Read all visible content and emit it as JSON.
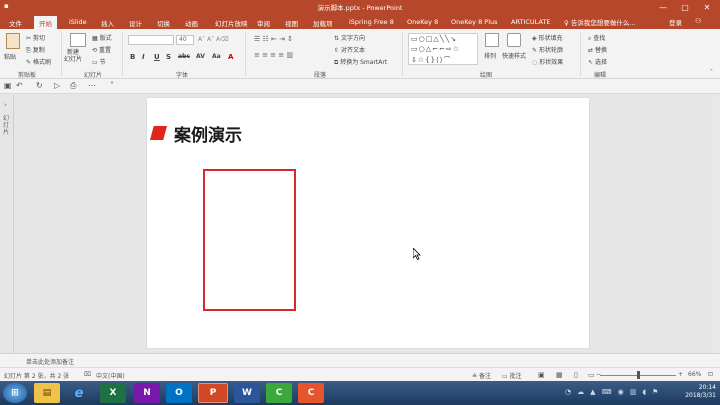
{
  "window": {
    "title": "演示脚本.pptx - PowerPoint",
    "controls": [
      "—",
      "▢",
      "✕"
    ]
  },
  "tabs": [
    {
      "label": "文件",
      "active": false
    },
    {
      "label": "开始",
      "active": true
    },
    {
      "label": "iSlide",
      "active": false
    },
    {
      "label": "插入",
      "active": false
    },
    {
      "label": "设计",
      "active": false
    },
    {
      "label": "切换",
      "active": false
    },
    {
      "label": "动画",
      "active": false
    },
    {
      "label": "幻灯片放映",
      "active": false
    },
    {
      "label": "审阅",
      "active": false
    },
    {
      "label": "视图",
      "active": false
    },
    {
      "label": "加载项",
      "active": false
    },
    {
      "label": "iSpring Free 8",
      "active": false
    },
    {
      "label": "OneKey 8",
      "active": false
    },
    {
      "label": "OneKey 8 Plus",
      "active": false
    },
    {
      "label": "ARTICULATE",
      "active": false
    }
  ],
  "tell_me": "告诉我您想要做什么...",
  "login": "登录",
  "share_icon": "person-share-icon",
  "ribbon": {
    "clipboard": {
      "paste": "粘贴",
      "cut": "剪切",
      "copy": "复制",
      "format_painter": "格式刷",
      "group_label": "剪贴板"
    },
    "slides": {
      "new_slide": "新建\n幻灯片",
      "layout": "版式",
      "reset": "重置",
      "section": "节",
      "group_label": "幻灯片"
    },
    "font": {
      "font_name": "",
      "font_size": "40",
      "group_label": "字体",
      "buttons": [
        "B",
        "I",
        "U",
        "S",
        "abc",
        "AV",
        "Aa",
        "A"
      ]
    },
    "paragraph": {
      "text_direction": "文字方向",
      "align_text": "对齐文本",
      "smartart": "转换为 SmartArt",
      "group_label": "段落"
    },
    "drawing": {
      "arrange": "排列",
      "quick_styles": "快速样式",
      "shape_fill": "形状填充",
      "shape_outline": "形状轮廓",
      "shape_effects": "形状效果",
      "group_label": "绘图"
    },
    "editing": {
      "find": "查找",
      "replace": "替换",
      "select": "选择",
      "group_label": "编辑"
    }
  },
  "left_panel_label": "幻灯片",
  "slide": {
    "title": "案例演示",
    "accent_color": "#e1251b",
    "box_color": "#d9272e"
  },
  "notes_placeholder": "单击此处添加备注",
  "status": {
    "slide_info": "幻灯片 第 2 张，共 2 张",
    "language": "中文(中国)",
    "notes": "备注",
    "comments": "批注",
    "zoom": "66%"
  },
  "taskbar": {
    "apps": [
      {
        "name": "explorer",
        "glyph": "▤",
        "color": "#f0c14b"
      },
      {
        "name": "ie",
        "glyph": "e",
        "color": "#1e90ff"
      },
      {
        "name": "excel",
        "glyph": "X",
        "color": "#1e7145"
      },
      {
        "name": "onenote",
        "glyph": "N",
        "color": "#7719aa"
      },
      {
        "name": "outlook",
        "glyph": "O",
        "color": "#0072c6"
      },
      {
        "name": "powerpoint",
        "glyph": "P",
        "color": "#d24726"
      },
      {
        "name": "word",
        "glyph": "W",
        "color": "#2b579a"
      },
      {
        "name": "camtasia-green",
        "glyph": "C",
        "color": "#3aa83a"
      },
      {
        "name": "camtasia-red",
        "glyph": "C",
        "color": "#e8542b"
      }
    ],
    "time": "20:14",
    "date": "2018/3/31"
  }
}
